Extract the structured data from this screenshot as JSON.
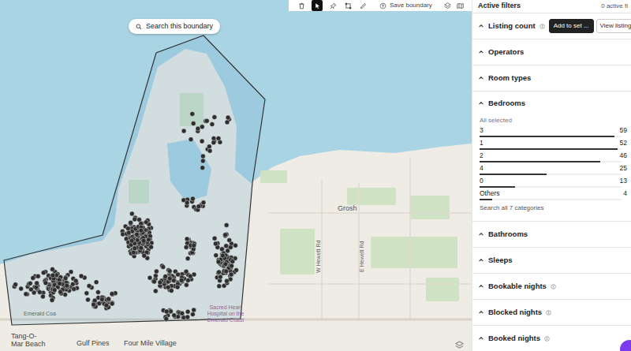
{
  "toolbar": {
    "tools": [
      {
        "kind": "delete",
        "selected": false
      },
      {
        "kind": "select",
        "selected": true
      },
      {
        "kind": "pin",
        "selected": false
      },
      {
        "kind": "rectangle",
        "selected": false
      },
      {
        "kind": "draw",
        "selected": false
      }
    ],
    "save_button": "Save boundary"
  },
  "map": {
    "search_button": "Search this boundary",
    "labels": [
      {
        "text": "Grosh",
        "color": "#555555"
      },
      {
        "text": "W Hewett Rd",
        "color": "#666666"
      },
      {
        "text": "E Hewett Rd",
        "color": "#666666"
      },
      {
        "text": "Emerald Coa",
        "color": "#666666"
      },
      {
        "text": "Sacred Heart Hospital on the Emerald Coast",
        "color": "#8e6a96"
      },
      {
        "text": "Tang-O-Mar Beach",
        "color": "#444444"
      },
      {
        "text": "Gulf Pines",
        "color": "#444444"
      },
      {
        "text": "Four Mile Village",
        "color": "#444444"
      }
    ]
  },
  "filters": {
    "title": "Active filters",
    "count": "0 active fi",
    "sections": [
      {
        "title": "Listing count",
        "info": true,
        "expanded": false,
        "actions": [
          {
            "label": "Add to set ...",
            "kind": "primary"
          },
          {
            "label": "View listing",
            "kind": "secondary"
          }
        ]
      },
      {
        "title": "Operators",
        "info": false,
        "expanded": false
      },
      {
        "title": "Room types",
        "info": false,
        "expanded": false
      },
      {
        "title": "Bedrooms",
        "info": false,
        "expanded": true,
        "summary": "All selected",
        "options": [
          {
            "label": "3",
            "count": "59",
            "level": 0.95
          },
          {
            "label": "1",
            "count": "52",
            "level": 0.97
          },
          {
            "label": "2",
            "count": "46",
            "level": 0.85
          },
          {
            "label": "4",
            "count": "25",
            "level": 0.47
          },
          {
            "label": "0",
            "count": "13",
            "level": 0.25
          },
          {
            "label": "Others",
            "count": "4",
            "level": 0.09
          }
        ],
        "more": "Search all 7 categories"
      },
      {
        "title": "Bathrooms",
        "info": false,
        "expanded": false
      },
      {
        "title": "Sleeps",
        "info": false,
        "expanded": false
      },
      {
        "title": "Bookable nights",
        "info": true,
        "expanded": false
      },
      {
        "title": "Blocked nights",
        "info": true,
        "expanded": false
      },
      {
        "title": "Booked nights",
        "info": true,
        "expanded": false
      }
    ]
  }
}
